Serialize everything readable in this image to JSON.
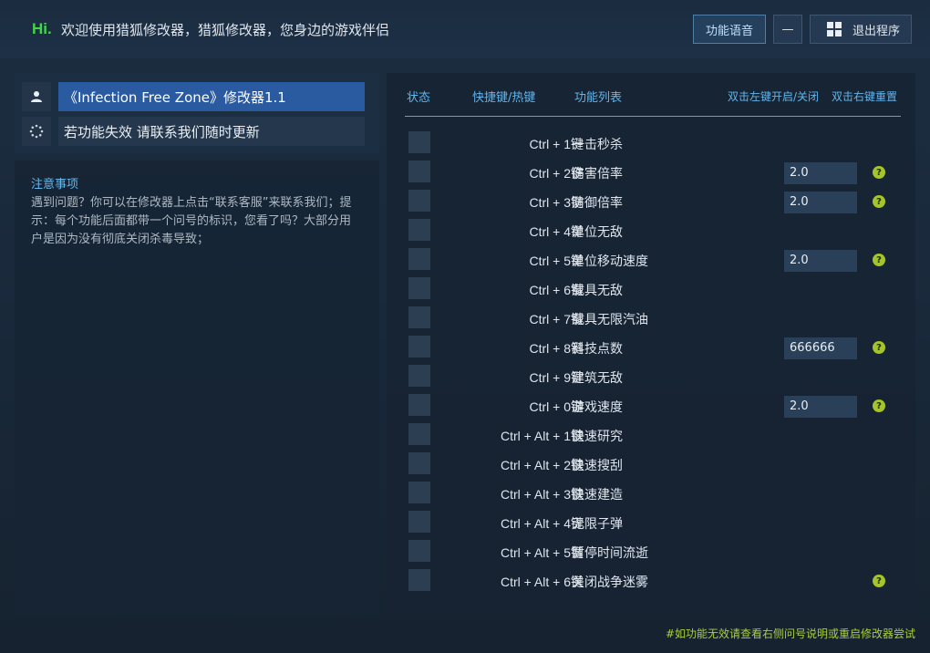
{
  "header": {
    "hi": "Hi.",
    "welcome": "欢迎使用猎狐修改器，猎狐修改器，您身边的游戏伴侣",
    "voice_button": "功能语音",
    "minimize_button": "—",
    "exit_button": "退出程序"
  },
  "left": {
    "trainer_title": "《Infection Free Zone》修改器1.1",
    "contact_text": "若功能失效  请联系我们随时更新",
    "notes_title": "注意事项",
    "notes_body": "遇到问题？你可以在修改器上点击“联系客服”来联系我们；提示：每个功能后面都带一个问号的标识，您看了吗？大部分用户是因为没有彻底关闭杀毒导致；"
  },
  "table": {
    "col_status": "状态",
    "col_hotkey": "快捷键/热键",
    "col_function": "功能列表",
    "col_dblleft": "双击左键开启/关闭",
    "col_dblright": "双击右键重置",
    "rows": [
      {
        "hotkey": "Ctrl + 1键",
        "name": "一击秒杀",
        "value": null,
        "help": false
      },
      {
        "hotkey": "Ctrl + 2键",
        "name": "伤害倍率",
        "value": "2.0",
        "help": true
      },
      {
        "hotkey": "Ctrl + 3键",
        "name": "防御倍率",
        "value": "2.0",
        "help": true
      },
      {
        "hotkey": "Ctrl + 4键",
        "name": "单位无敌",
        "value": null,
        "help": false
      },
      {
        "hotkey": "Ctrl + 5键",
        "name": "单位移动速度",
        "value": "2.0",
        "help": true
      },
      {
        "hotkey": "Ctrl + 6键",
        "name": "载具无敌",
        "value": null,
        "help": false
      },
      {
        "hotkey": "Ctrl + 7键",
        "name": "载具无限汽油",
        "value": null,
        "help": false
      },
      {
        "hotkey": "Ctrl + 8键",
        "name": "科技点数",
        "value": "666666",
        "help": true
      },
      {
        "hotkey": "Ctrl + 9键",
        "name": "建筑无敌",
        "value": null,
        "help": false
      },
      {
        "hotkey": "Ctrl + 0键",
        "name": "游戏速度",
        "value": "2.0",
        "help": true
      },
      {
        "hotkey": "Ctrl + Alt + 1键",
        "name": "快速研究",
        "value": null,
        "help": false
      },
      {
        "hotkey": "Ctrl + Alt + 2键",
        "name": "快速搜刮",
        "value": null,
        "help": false
      },
      {
        "hotkey": "Ctrl + Alt + 3键",
        "name": "快速建造",
        "value": null,
        "help": false
      },
      {
        "hotkey": "Ctrl + Alt + 4键",
        "name": "无限子弹",
        "value": null,
        "help": false
      },
      {
        "hotkey": "Ctrl + Alt + 5键",
        "name": "暂停时间流逝",
        "value": null,
        "help": false
      },
      {
        "hotkey": "Ctrl + Alt + 6键",
        "name": "关闭战争迷雾",
        "value": null,
        "help": true
      }
    ],
    "help_glyph": "?"
  },
  "footer": "#如功能无效请查看右侧问号说明或重启修改器尝试"
}
